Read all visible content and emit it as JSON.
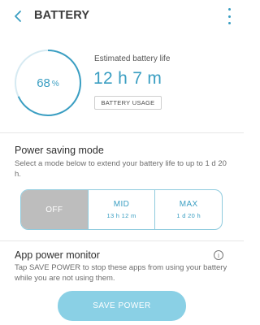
{
  "header": {
    "title": "BATTERY",
    "back_icon": "chevron-left-icon",
    "more_icon": "more-vertical-icon"
  },
  "battery": {
    "percent_value": "68",
    "percent_symbol": "%",
    "level_fraction": 0.68,
    "estimated_label": "Estimated battery life",
    "estimated_value": "12 h 7 m",
    "usage_button": "BATTERY USAGE"
  },
  "power_saving": {
    "title": "Power saving mode",
    "description": "Select a mode below to extend your battery life to up to 1 d 20 h.",
    "modes": [
      {
        "label": "OFF",
        "sub": "",
        "selected": true
      },
      {
        "label": "MID",
        "sub": "13 h 12 m",
        "selected": false
      },
      {
        "label": "MAX",
        "sub": "1 d 20 h",
        "selected": false
      }
    ]
  },
  "app_monitor": {
    "title": "App power monitor",
    "info_icon": "info-icon",
    "description": "Tap SAVE POWER to stop these apps from using your battery while you are not using them.",
    "save_button": "SAVE POWER"
  },
  "colors": {
    "accent": "#3a9ec2",
    "ring_track": "#d6eaf2",
    "segment_border": "#8fcbde",
    "selected_segment": "#bdbdbd",
    "save_button": "#8ad0e5"
  }
}
